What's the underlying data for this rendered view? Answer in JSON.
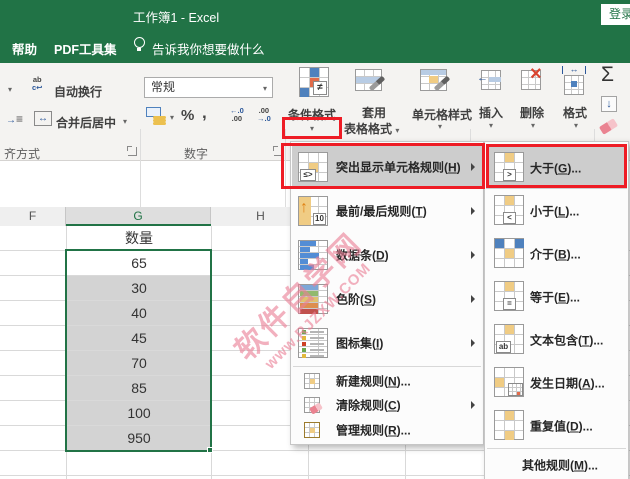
{
  "titlebar": {
    "title": "工作簿1 - Excel",
    "sign_in": "登录"
  },
  "tabs": {
    "help": "帮助",
    "pdf": "PDF工具集",
    "tell_me": "告诉我你想要做什么"
  },
  "ribbon": {
    "alignment": {
      "wrap_text": "自动换行",
      "merge_center": "合并后居中",
      "group": "齐方式"
    },
    "number": {
      "format": "常规",
      "percent": "%",
      "comma": ",",
      "inc_top": "←.0",
      "inc_bottom": ".00",
      "dec_top": ".00",
      "dec_bottom": "→.0",
      "group": "数字"
    },
    "styles": {
      "conditional_formatting": "条件格式",
      "format_as_table_line1": "套用",
      "format_as_table_line2": "表格格式",
      "cell_styles": "单元格样式"
    },
    "cells": {
      "insert": "插入",
      "delete": "删除",
      "format": "格式"
    },
    "editing": {
      "autosum": "Σ"
    }
  },
  "icons": {
    "caret": "▾",
    "wrap_line1": "ab",
    "wrap_line2": "c↩",
    "merge_arrow": "↔",
    "indent_arrow": "→",
    "indent_lines": "≡",
    "format_arrow": "↔",
    "fill_arrow": "↓",
    "delete_x": "×",
    "up_arrow": "↑",
    "badge_neq": "≠",
    "badge_hl": "≤>",
    "badge_top10": "10",
    "badge_gt": ">",
    "badge_lt": "<",
    "badge_eq": "=",
    "badge_ab": "ab"
  },
  "sheet": {
    "cols": {
      "f": "F",
      "g": "G",
      "h": "H"
    },
    "rows": [
      "数量",
      "65",
      "30",
      "40",
      "45",
      "70",
      "85",
      "100",
      "950"
    ]
  },
  "watermark": {
    "line1": "软件自学网",
    "line2": "www.RJZXW.COM"
  },
  "menu": {
    "items": [
      {
        "pre": "突出显示单元格规则(",
        "key": "H",
        "post": ")"
      },
      {
        "pre": "最前/最后规则(",
        "key": "T",
        "post": ")"
      },
      {
        "pre": "数据条(",
        "key": "D",
        "post": ")"
      },
      {
        "pre": "色阶(",
        "key": "S",
        "post": ")"
      },
      {
        "pre": "图标集(",
        "key": "I",
        "post": ")"
      },
      {
        "pre": "新建规则(",
        "key": "N",
        "post": ")..."
      },
      {
        "pre": "清除规则(",
        "key": "C",
        "post": ")"
      },
      {
        "pre": "管理规则(",
        "key": "R",
        "post": ")..."
      }
    ]
  },
  "submenu": {
    "items": [
      {
        "pre": "大于(",
        "key": "G",
        "post": ")..."
      },
      {
        "pre": "小于(",
        "key": "L",
        "post": ")..."
      },
      {
        "pre": "介于(",
        "key": "B",
        "post": ")..."
      },
      {
        "pre": "等于(",
        "key": "E",
        "post": ")..."
      },
      {
        "pre": "文本包含(",
        "key": "T",
        "post": ")..."
      },
      {
        "pre": "发生日期(",
        "key": "A",
        "post": ")..."
      },
      {
        "pre": "重复值(",
        "key": "D",
        "post": ")..."
      },
      {
        "pre": "其他规则(",
        "key": "M",
        "post": ")..."
      }
    ]
  },
  "colors": {
    "excel_green": "#217346",
    "annotation_red": "#ee1c25",
    "selection_gray": "#d3d3d3",
    "watermark_pink": "#ea8096"
  }
}
